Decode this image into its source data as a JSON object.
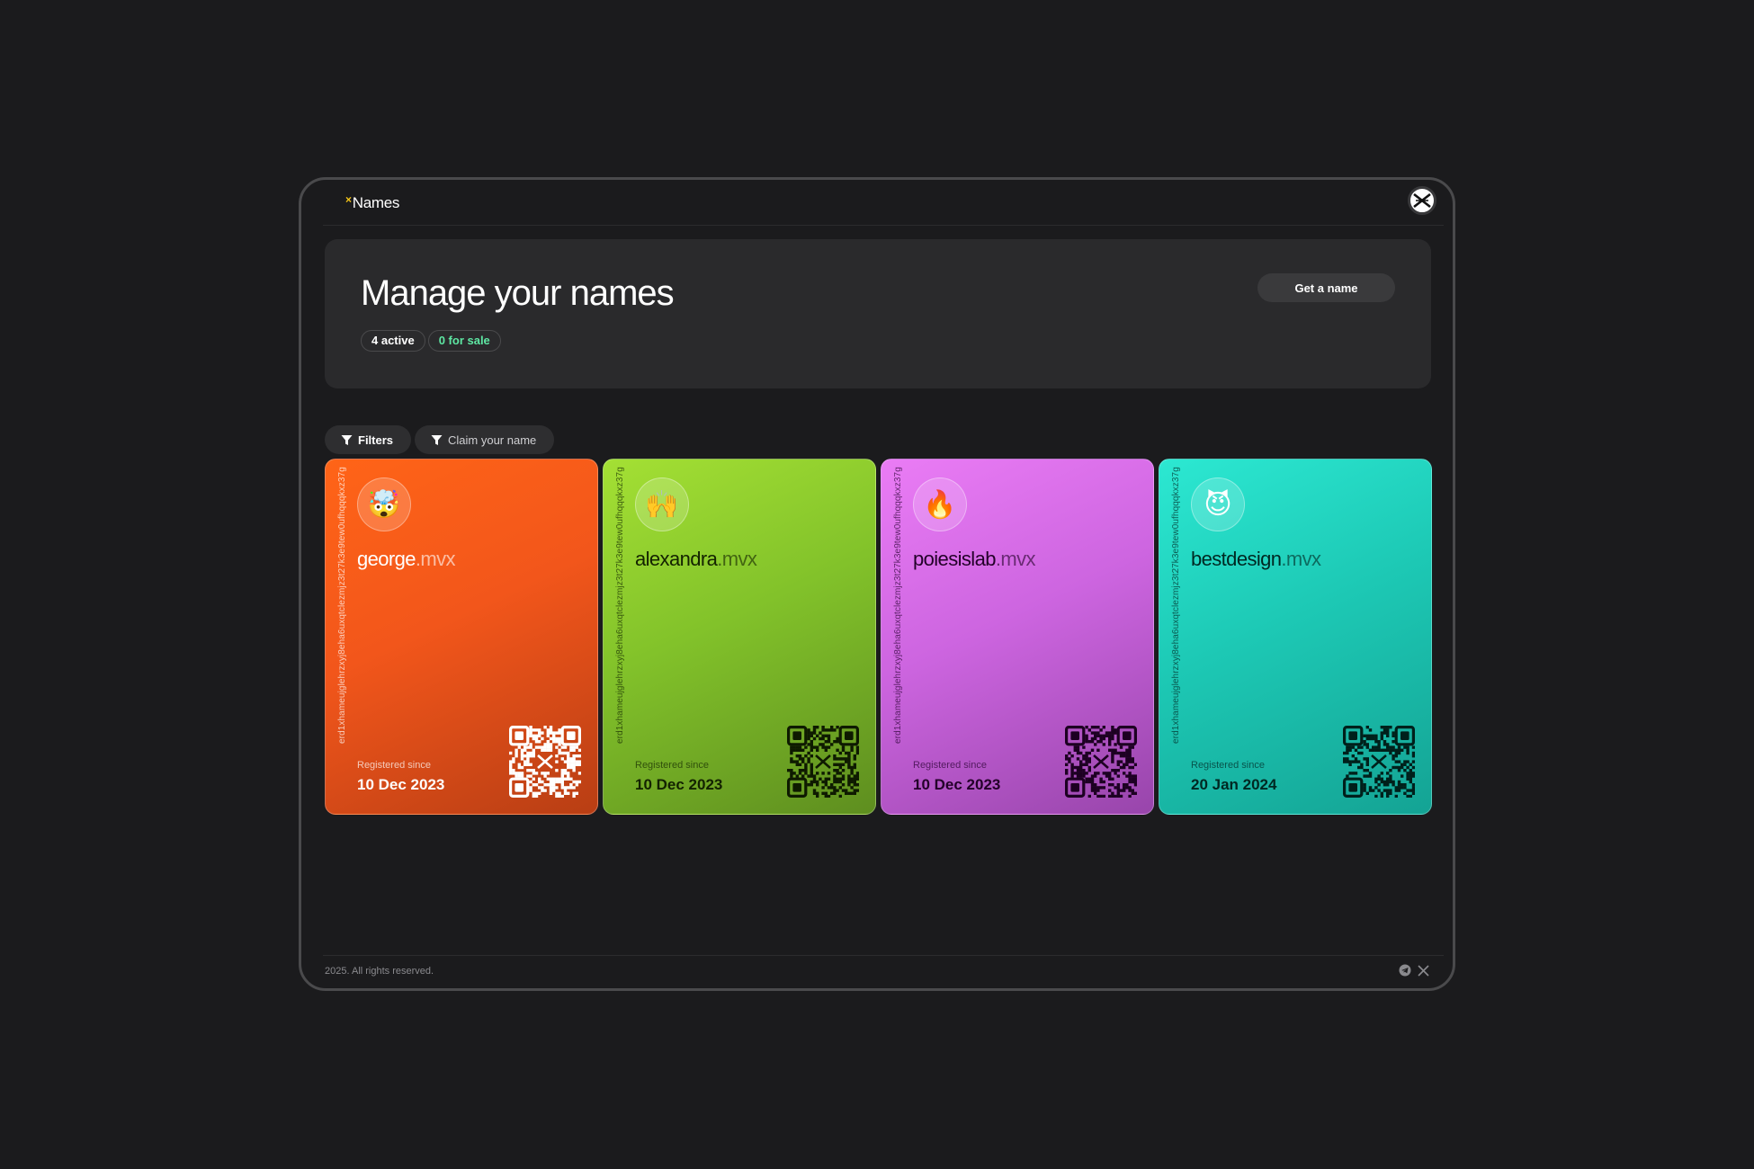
{
  "app": {
    "title": "Names",
    "brand_mark": "×"
  },
  "hero": {
    "title": "Manage your names",
    "active_badge": "4 active",
    "sale_badge": "0 for sale",
    "cta": "Get a name"
  },
  "toolbar": {
    "filters_label": "Filters",
    "claim_label": "Claim your name"
  },
  "colors": {
    "orange": "#f2561b",
    "green": "#82c22a",
    "purple": "#cd65e0",
    "teal": "#1dc9b5",
    "sale_badge": "#5ee7a3"
  },
  "cards": [
    {
      "address": "erd1xhameujglehrzxyj8eha6uxqtclezmjz3t27k3e9tew0ufhqqqkxz37g",
      "avatar": "🤯",
      "avatar_icon": "exploding-head-emoji",
      "name": "george",
      "tld": ".mvx",
      "registered_label": "Registered since",
      "registered_date": "10 Dec 2023"
    },
    {
      "address": "erd1xhameujglehrzxyj8eha6uxqtclezmjz3t27k3e9tew0ufhqqqkxz37g",
      "avatar": "🙌",
      "avatar_icon": "raising-hands-emoji",
      "name": "alexandra",
      "tld": ".mvx",
      "registered_label": "Registered since",
      "registered_date": "10 Dec 2023"
    },
    {
      "address": "erd1xhameujglehrzxyj8eha6uxqtclezmjz3t27k3e9tew0ufhqqqkxz37g",
      "avatar": "🔥",
      "avatar_icon": "fire-emoji",
      "name": "poiesislab",
      "tld": ".mvx",
      "registered_label": "Registered since",
      "registered_date": "10 Dec 2023"
    },
    {
      "address": "erd1xhameujglehrzxyj8eha6uxqtclezmjz3t27k3e9tew0ufhqqqkxz37g",
      "avatar": "😈",
      "avatar_icon": "smiling-devil-emoji",
      "name": "bestdesign",
      "tld": ".mvx",
      "registered_label": "Registered since",
      "registered_date": "20 Jan 2024"
    }
  ],
  "footer": {
    "copyright": "2025. All rights reserved."
  }
}
